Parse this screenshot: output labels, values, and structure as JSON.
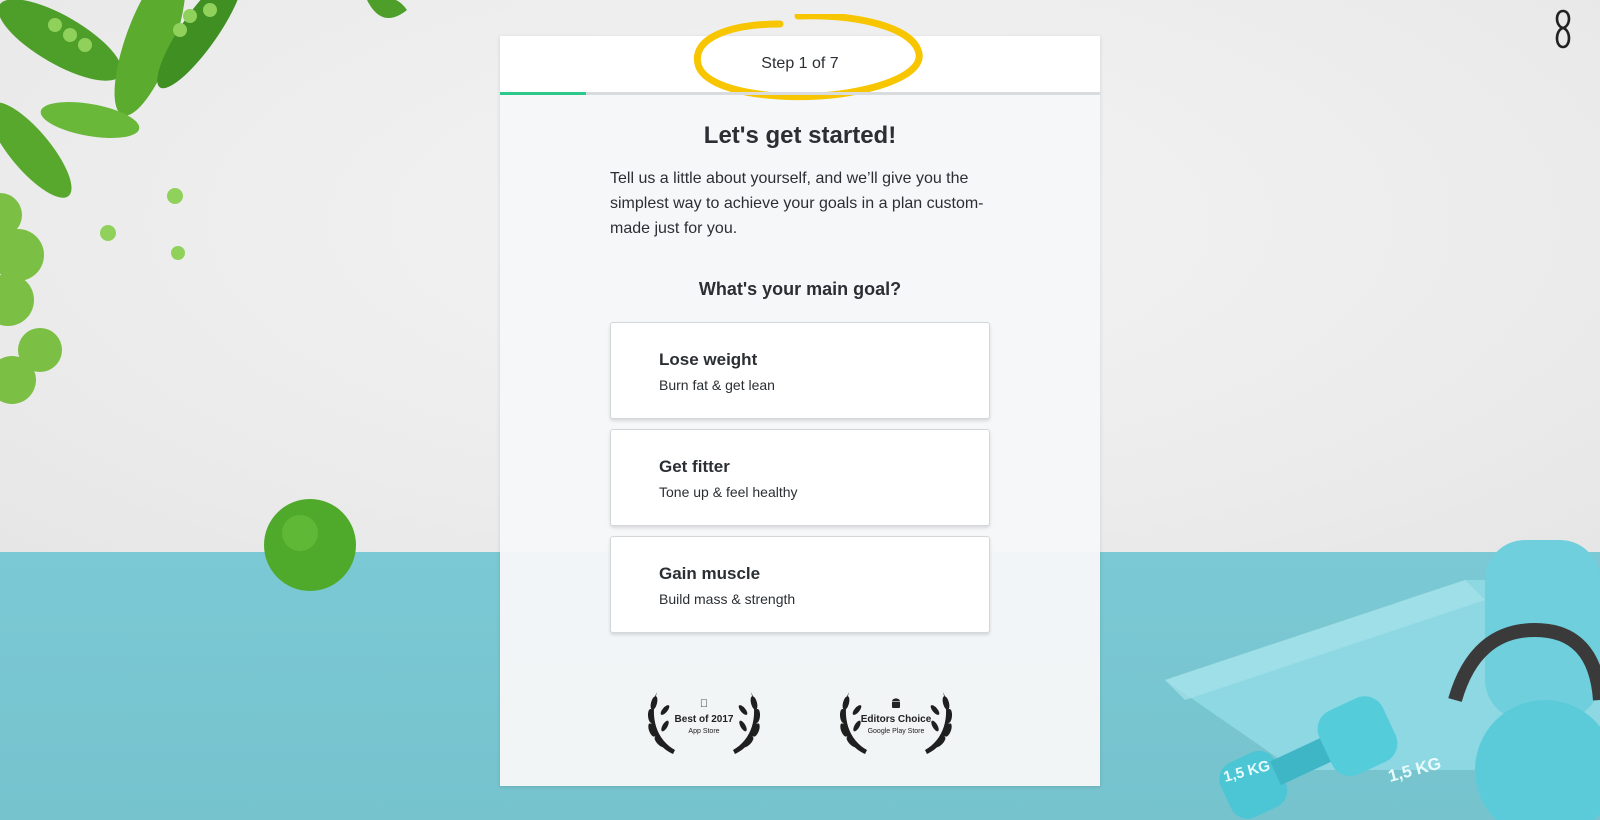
{
  "header": {
    "step_text": "Step 1 of 7",
    "progress": 0.143
  },
  "main": {
    "title": "Let's get started!",
    "intro": "Tell us a little about yourself, and we’ll give you the simplest way to achieve your goals in a plan custom-made just for you.",
    "question": "What's your main goal?",
    "options": [
      {
        "title": "Lose weight",
        "subtitle": "Burn fat & get lean"
      },
      {
        "title": "Get fitter",
        "subtitle": "Tone up & feel healthy"
      },
      {
        "title": "Gain muscle",
        "subtitle": "Build mass & strength"
      }
    ]
  },
  "awards": [
    {
      "title": "Best of 2017",
      "subtitle": "App Store",
      "icon": "apple-icon"
    },
    {
      "title": "Editors Choice",
      "subtitle": "Google Play Store",
      "icon": "android-icon"
    }
  ],
  "decor": {
    "dumbbell_labels": [
      "1,5 KG",
      "1,5 KG"
    ]
  },
  "colors": {
    "progress": "#2dc98c",
    "annotation": "#f7c600",
    "floor": "#79c6d1"
  }
}
